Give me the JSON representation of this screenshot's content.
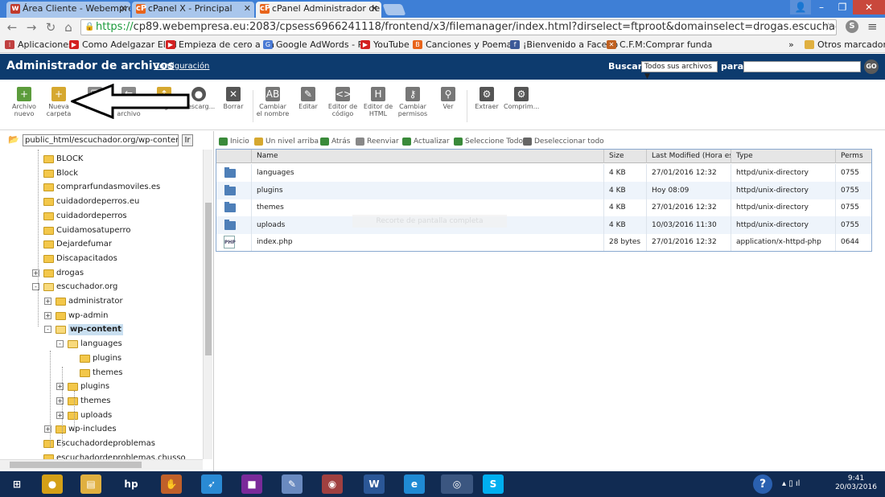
{
  "browser": {
    "tabs": [
      {
        "label": "Área Cliente - Webempre",
        "favicon": "webempresa-icon",
        "active": false
      },
      {
        "label": "cPanel X - Principal",
        "favicon": "cpanel-icon",
        "active": false
      },
      {
        "label": "cPanel Administrador de a",
        "favicon": "cpanel-icon",
        "active": true
      }
    ],
    "url_scheme": "https://",
    "url_rest": "cp89.webempresa.eu:2083/cpsess6966241118/frontend/x3/filemanager/index.html?dirselect=ftproot&domainselect=drogas.escuchador.org&dir=%2Fhc",
    "bookmarks": [
      "Aplicaciones",
      "Como Adelgazar El Al",
      "Empieza de cero a ha",
      "Google AdWords - Pu",
      "YouTube",
      "Canciones y Poemas:",
      "¡Bienvenido a Facebo",
      "C.F.M:Comprar funda"
    ],
    "bookmarks_more": "»",
    "other_bookmarks": "Otros marcadores"
  },
  "cpanel": {
    "title": "Administrador de archivos",
    "config_link": "Configuración",
    "search_label": "Buscar",
    "search_scope": "Todos sus archivos ▼",
    "para_label": "para",
    "go_label": "GO"
  },
  "toolbar": [
    {
      "label": "Archivo nuevo",
      "icon": "new-file-icon",
      "color": "#5c9c3c"
    },
    {
      "label": "Nueva carpeta",
      "icon": "new-folder-icon",
      "color": "#d6a830"
    },
    {
      "label": "Copiar",
      "icon": "copy-icon",
      "color": "#8a8a8a"
    },
    {
      "label": "Trasladar archivo",
      "icon": "move-icon",
      "color": "#8a8a8a"
    },
    {
      "label": "Cargar",
      "icon": "upload-icon",
      "color": "#d6a830"
    },
    {
      "label": "Descarg...",
      "icon": "download-icon",
      "color": "#555555"
    },
    {
      "label": "Borrar",
      "icon": "delete-icon",
      "color": "#555555"
    },
    {
      "label": "Cambiar el nombre",
      "icon": "rename-icon",
      "color": "#777777"
    },
    {
      "label": "Editar",
      "icon": "edit-icon",
      "color": "#777777"
    },
    {
      "label": "Editor de código",
      "icon": "code-editor-icon",
      "color": "#777777"
    },
    {
      "label": "Editor de HTML",
      "icon": "html-editor-icon",
      "color": "#777777"
    },
    {
      "label": "Cambiar permisos",
      "icon": "permissions-icon",
      "color": "#777777"
    },
    {
      "label": "Ver",
      "icon": "view-icon",
      "color": "#777777"
    },
    {
      "label": "Extraer",
      "icon": "extract-icon",
      "color": "#555555"
    },
    {
      "label": "Comprim...",
      "icon": "compress-icon",
      "color": "#555555"
    }
  ],
  "tree": {
    "path_value": "public_html/escuchador.org/wp-content",
    "go_button": "Ir",
    "nodes": [
      {
        "label": "BLOCK",
        "depth": 0,
        "expander": "",
        "open": false,
        "selected": false
      },
      {
        "label": "Block",
        "depth": 0,
        "expander": "",
        "open": false,
        "selected": false
      },
      {
        "label": "comprarfundasmoviles.es",
        "depth": 0,
        "expander": "",
        "open": false,
        "selected": false
      },
      {
        "label": "cuidadordeperros.eu",
        "depth": 0,
        "expander": "",
        "open": false,
        "selected": false
      },
      {
        "label": "cuidadordeperros",
        "depth": 0,
        "expander": "",
        "open": false,
        "selected": false
      },
      {
        "label": "Cuidamosatuperro",
        "depth": 0,
        "expander": "",
        "open": false,
        "selected": false
      },
      {
        "label": "Dejardefumar",
        "depth": 0,
        "expander": "",
        "open": false,
        "selected": false
      },
      {
        "label": "Discapacitados",
        "depth": 0,
        "expander": "",
        "open": false,
        "selected": false
      },
      {
        "label": "drogas",
        "depth": 0,
        "expander": "+",
        "open": false,
        "selected": false
      },
      {
        "label": "escuchador.org",
        "depth": 0,
        "expander": "-",
        "open": true,
        "selected": false
      },
      {
        "label": "administrator",
        "depth": 1,
        "expander": "+",
        "open": false,
        "selected": false
      },
      {
        "label": "wp-admin",
        "depth": 1,
        "expander": "+",
        "open": false,
        "selected": false
      },
      {
        "label": "wp-content",
        "depth": 1,
        "expander": "-",
        "open": true,
        "selected": true
      },
      {
        "label": "languages",
        "depth": 2,
        "expander": "-",
        "open": true,
        "selected": false
      },
      {
        "label": "plugins",
        "depth": 3,
        "expander": "",
        "open": false,
        "selected": false
      },
      {
        "label": "themes",
        "depth": 3,
        "expander": "",
        "open": false,
        "selected": false
      },
      {
        "label": "plugins",
        "depth": 2,
        "expander": "+",
        "open": false,
        "selected": false
      },
      {
        "label": "themes",
        "depth": 2,
        "expander": "+",
        "open": false,
        "selected": false
      },
      {
        "label": "uploads",
        "depth": 2,
        "expander": "+",
        "open": false,
        "selected": false
      },
      {
        "label": "wp-includes",
        "depth": 1,
        "expander": "+",
        "open": false,
        "selected": false
      },
      {
        "label": "Escuchadordeproblemas",
        "depth": 0,
        "expander": "",
        "open": false,
        "selected": false
      },
      {
        "label": "escuchadordeproblemas.chusso",
        "depth": 0,
        "expander": "",
        "open": false,
        "selected": false
      }
    ]
  },
  "filenav": [
    {
      "label": "Inicio",
      "icon": "home-icon",
      "color": "#3a8a3a"
    },
    {
      "label": "Un nivel arriba",
      "icon": "up-level-icon",
      "color": "#d6a830"
    },
    {
      "label": "Atrás",
      "icon": "back-icon",
      "color": "#3a8a3a"
    },
    {
      "label": "Reenviar",
      "icon": "forward-icon",
      "color": "#888888"
    },
    {
      "label": "Actualizar",
      "icon": "refresh-icon",
      "color": "#3a8a3a"
    },
    {
      "label": "Seleccione Todo",
      "icon": "select-all-icon",
      "color": "#3a8a3a"
    },
    {
      "label": "Deseleccionar todo",
      "icon": "deselect-all-icon",
      "color": "#666666"
    }
  ],
  "files": {
    "headers": [
      "",
      "Name",
      "Size",
      "Last Modified (Hora estÃ",
      "Type",
      "Perms"
    ],
    "rows": [
      {
        "kind": "folder",
        "name": "languages",
        "size": "4 KB",
        "modified": "27/01/2016 12:32",
        "type": "httpd/unix-directory",
        "perms": "0755"
      },
      {
        "kind": "folder",
        "name": "plugins",
        "size": "4 KB",
        "modified": "Hoy 08:09",
        "type": "httpd/unix-directory",
        "perms": "0755"
      },
      {
        "kind": "folder",
        "name": "themes",
        "size": "4 KB",
        "modified": "27/01/2016 12:32",
        "type": "httpd/unix-directory",
        "perms": "0755"
      },
      {
        "kind": "folder",
        "name": "uploads",
        "size": "4 KB",
        "modified": "10/03/2016 11:30",
        "type": "httpd/unix-directory",
        "perms": "0755"
      },
      {
        "kind": "php",
        "name": "index.php",
        "size": "28 bytes",
        "modified": "27/01/2016 12:32",
        "type": "application/x-httpd-php",
        "perms": "0644"
      }
    ],
    "php_badge": "PHP"
  },
  "overlay_text": "Recorte de pantalla completa",
  "taskbar": {
    "apps": [
      {
        "name": "start-button",
        "glyph": "⊞",
        "color": "#112b52"
      },
      {
        "name": "media-app-icon",
        "glyph": "●",
        "color": "#d4a017"
      },
      {
        "name": "file-explorer-icon",
        "glyph": "▤",
        "color": "#e0b040"
      },
      {
        "name": "hp-icon",
        "glyph": "hp",
        "color": "#112b52"
      },
      {
        "name": "glove-app-icon",
        "glyph": "✋",
        "color": "#c0602a"
      },
      {
        "name": "rocket-app-icon",
        "glyph": "➶",
        "color": "#2a8ad4"
      },
      {
        "name": "paint-app-icon",
        "glyph": "■",
        "color": "#7a2a9a"
      },
      {
        "name": "palette-app-icon",
        "glyph": "✎",
        "color": "#6a8ac0"
      },
      {
        "name": "game-app-icon",
        "glyph": "◉",
        "color": "#a04040"
      },
      {
        "name": "word-icon",
        "glyph": "W",
        "color": "#2b5797"
      },
      {
        "name": "ie-icon",
        "glyph": "e",
        "color": "#1f8ad4"
      },
      {
        "name": "chrome-icon",
        "glyph": "◎",
        "color": "#3b5680"
      },
      {
        "name": "skype-icon",
        "glyph": "S",
        "color": "#00aff0"
      }
    ],
    "help_glyph": "?",
    "tray_glyphs": "▴ ▯ ıl",
    "time": "9:41",
    "date": "20/03/2016"
  }
}
